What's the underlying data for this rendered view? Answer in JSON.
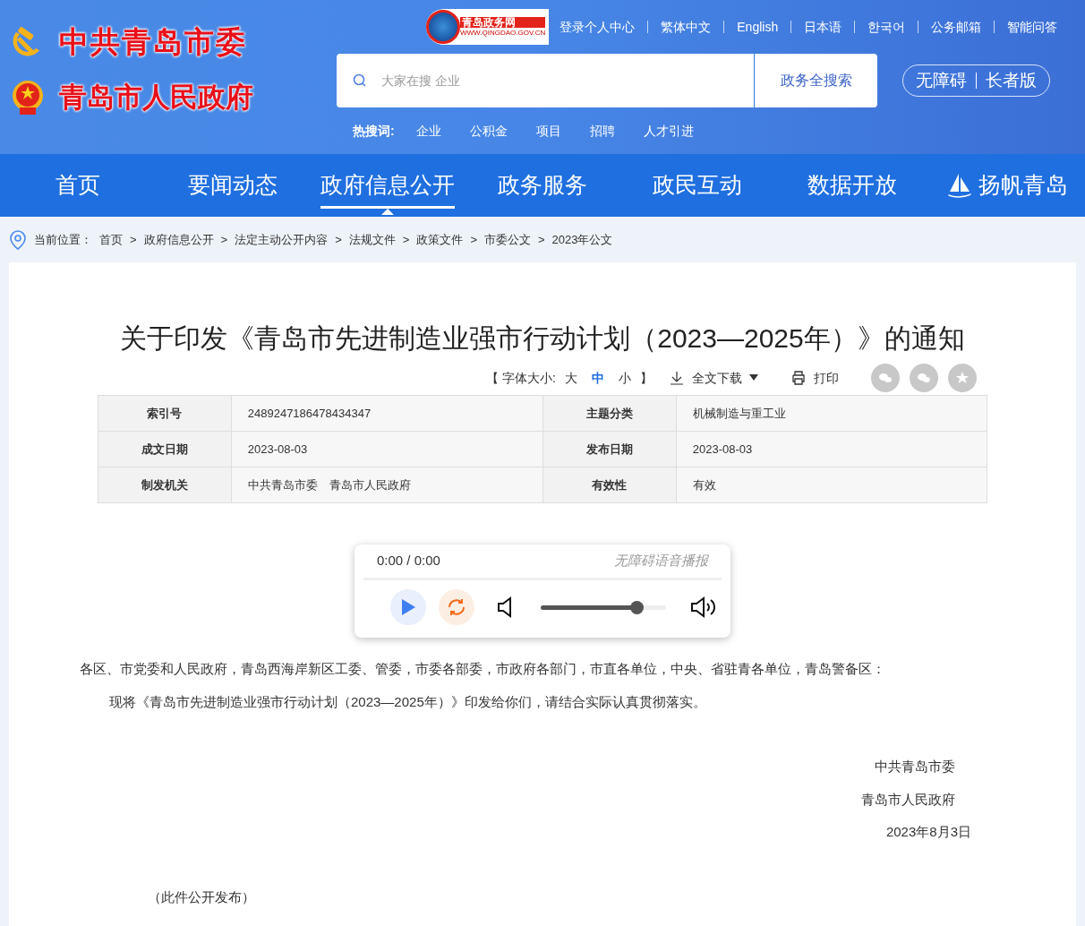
{
  "header": {
    "party_name": "中共青岛市委",
    "gov_name": "青岛市人民政府",
    "portal_logo": {
      "name": "青岛政务网",
      "url": "WWW.QINGDAO.GOV.CN"
    },
    "top_links": [
      "登录个人中心",
      "繁体中文",
      "English",
      "日本语",
      "한국어",
      "公务邮箱",
      "智能问答"
    ],
    "search": {
      "placeholder": "大家在搜 企业",
      "button": "政务全搜索"
    },
    "hot_label": "热搜词:",
    "hot_words": [
      "企业",
      "公积金",
      "项目",
      "招聘",
      "人才引进"
    ],
    "modes": [
      "无障碍",
      "长者版"
    ]
  },
  "nav": [
    {
      "label": "首页",
      "selected": false,
      "kind": "text"
    },
    {
      "label": "要闻动态",
      "selected": false,
      "kind": "text"
    },
    {
      "label": "政府信息公开",
      "selected": true,
      "kind": "text"
    },
    {
      "label": "政务服务",
      "selected": false,
      "kind": "text"
    },
    {
      "label": "政民互动",
      "selected": false,
      "kind": "text"
    },
    {
      "label": "数据开放",
      "selected": false,
      "kind": "text"
    },
    {
      "label": "扬帆青岛",
      "selected": false,
      "kind": "sail"
    }
  ],
  "breadcrumb": {
    "label": "当前位置：",
    "separator": ">",
    "items": [
      "首页",
      "政府信息公开",
      "法定主动公开内容",
      "法规文件",
      "政策文件",
      "市委公文",
      "2023年公文"
    ]
  },
  "article": {
    "title": "关于印发《青岛市先进制造业强市行动计划（2023—2025年）》的通知",
    "font_size": {
      "open": "【 字体大小:",
      "close": "】",
      "sizes": [
        {
          "label": "大",
          "selected": false
        },
        {
          "label": "中",
          "selected": true
        },
        {
          "label": "小",
          "selected": false
        }
      ]
    },
    "download": "全文下载",
    "print": "打印",
    "meta": [
      [
        {
          "label": "索引号",
          "value": "2489247186478434347"
        },
        {
          "label": "主题分类",
          "value": "机械制造与重工业"
        }
      ],
      [
        {
          "label": "成文日期",
          "value": "2023-08-03"
        },
        {
          "label": "发布日期",
          "value": "2023-08-03"
        }
      ],
      [
        {
          "label": "制发机关",
          "value": "中共青岛市委　青岛市人民政府"
        },
        {
          "label": "有效性",
          "value": "有效"
        }
      ]
    ],
    "player": {
      "time": "0:00 / 0:00",
      "label": "无障碍语音播报",
      "level": 0.77
    },
    "salutation": "各区、市党委和人民政府，青岛西海岸新区工委、管委，市委各部委，市政府各部门，市直各单位，中央、省驻青各单位，青岛警备区：",
    "body": "现将《青岛市先进制造业强市行动计划（2023—2025年）》印发给你们，请结合实际认真贯彻落实。",
    "signatures": [
      "中共青岛市委",
      "青岛市人民政府"
    ],
    "date": "2023年8月3日",
    "note": "（此件公开发布）"
  }
}
